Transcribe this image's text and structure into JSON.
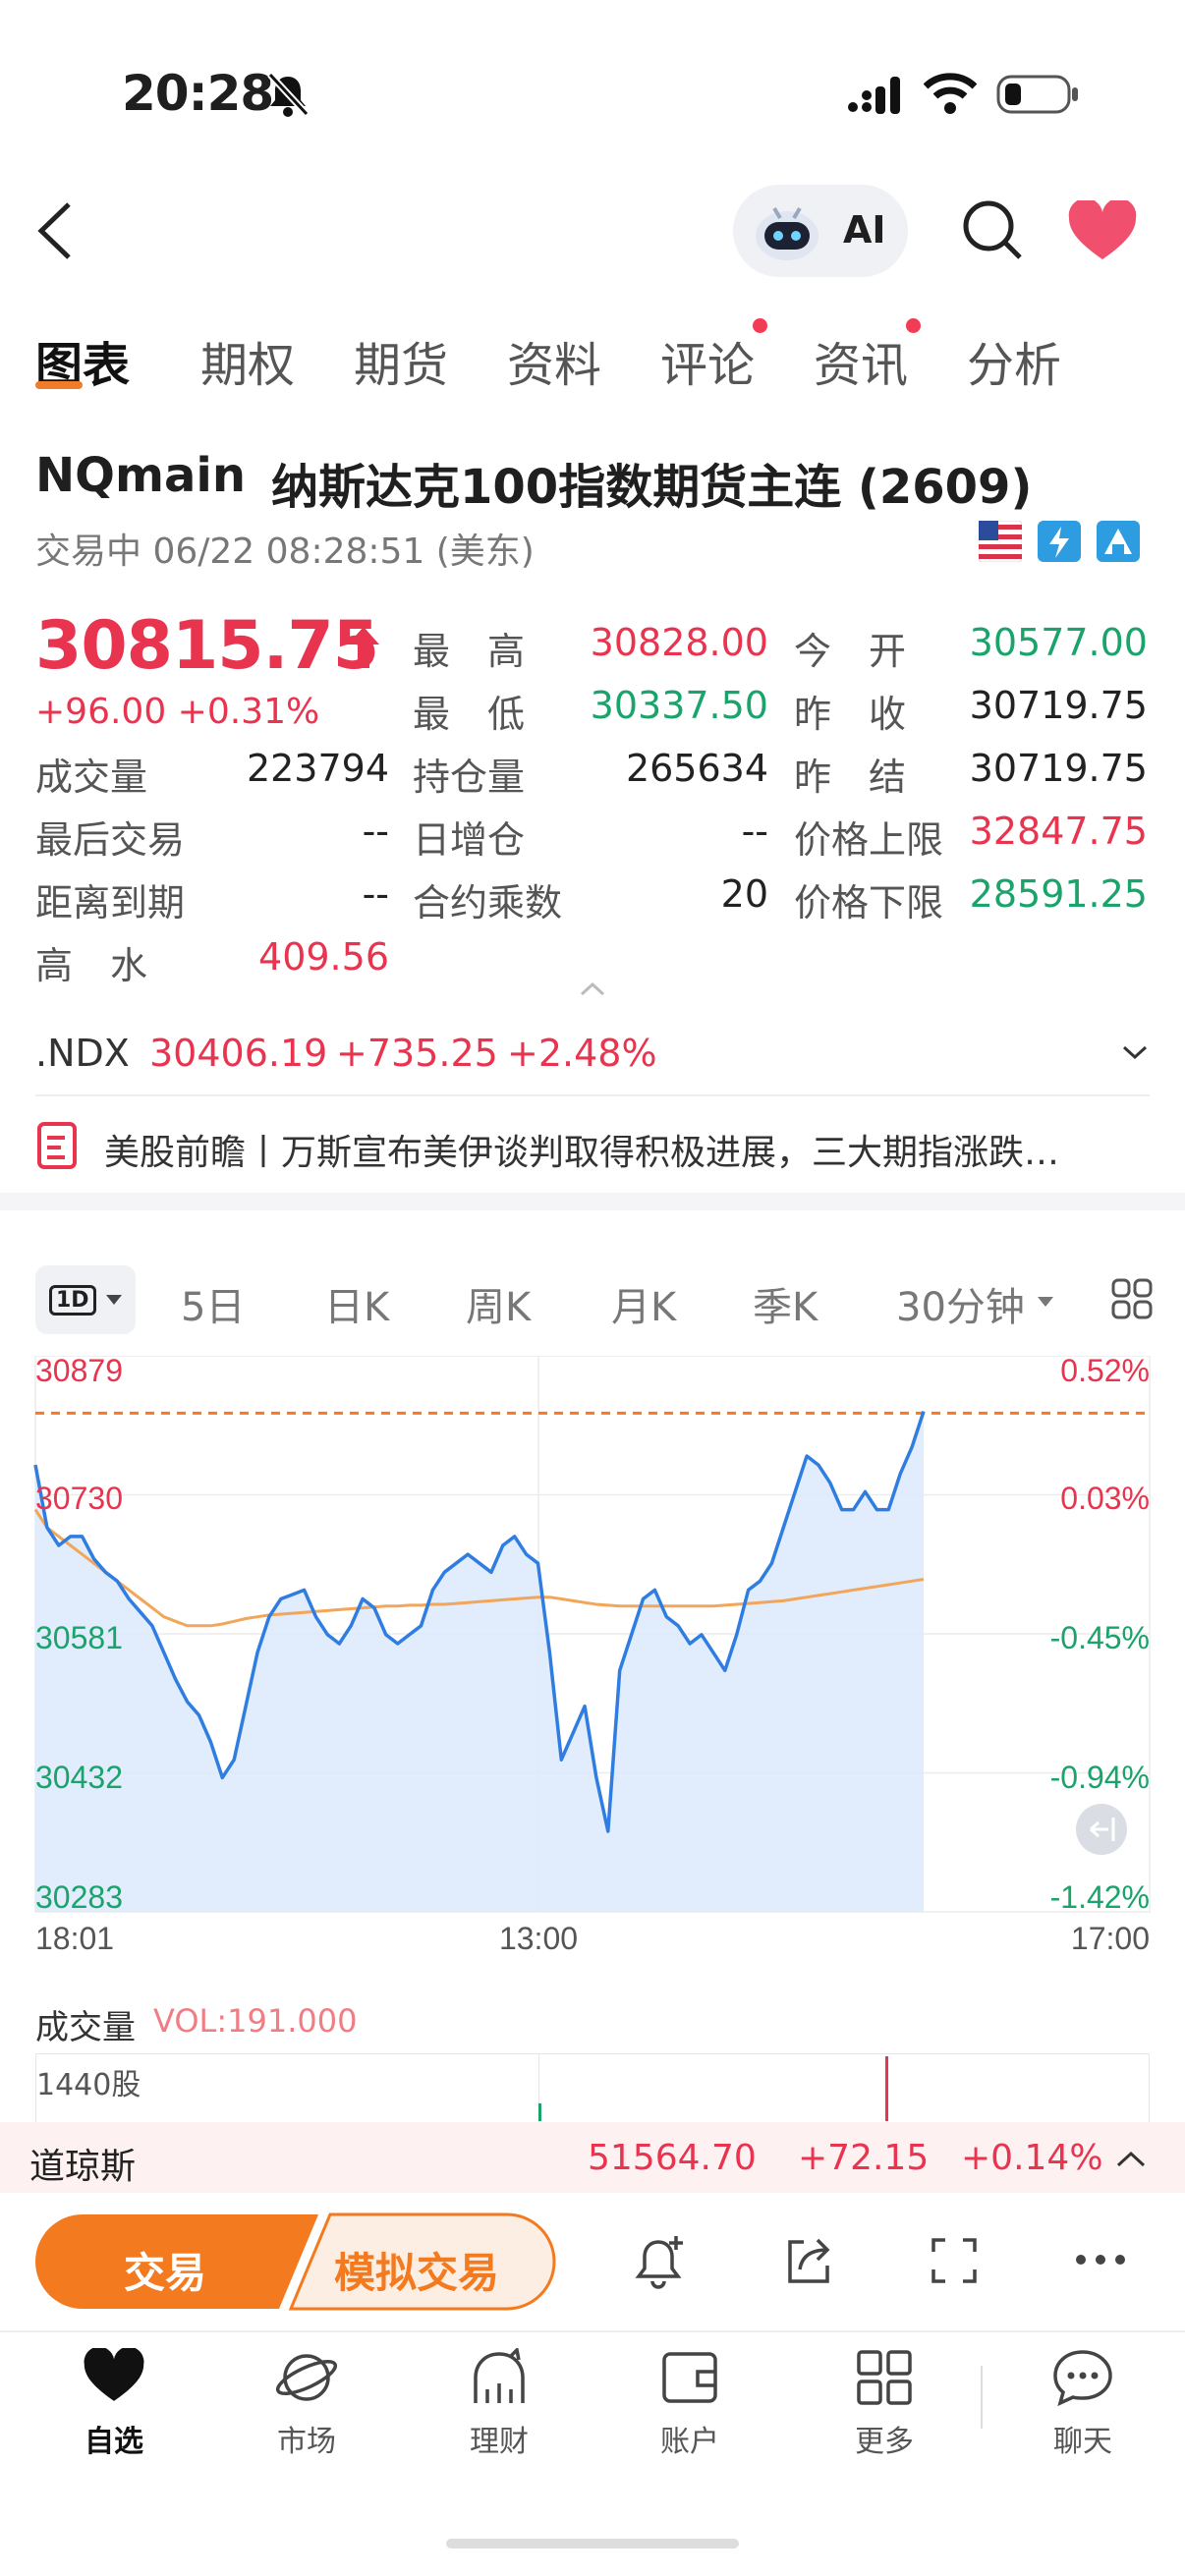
{
  "status": {
    "time": "20:28"
  },
  "header": {
    "ai_label": "AI"
  },
  "tabs": [
    {
      "label": "图表",
      "active": true,
      "dot": false
    },
    {
      "label": "期权",
      "active": false,
      "dot": false
    },
    {
      "label": "期货",
      "active": false,
      "dot": false
    },
    {
      "label": "资料",
      "active": false,
      "dot": false
    },
    {
      "label": "评论",
      "active": false,
      "dot": true
    },
    {
      "label": "资讯",
      "active": false,
      "dot": true
    },
    {
      "label": "分析",
      "active": false,
      "dot": false
    }
  ],
  "instrument": {
    "symbol": "NQmain",
    "name": "纳斯达克100指数期货主连 (2609)",
    "status": "交易中 06/22 08:28:51 (美东)"
  },
  "quote": {
    "price": "30815.75",
    "change": "+96.00 +0.31%",
    "high_label": "最　高",
    "high": "30828.00",
    "low_label": "最　低",
    "low": "30337.50",
    "open_label": "今　开",
    "open": "30577.00",
    "prev_close_label": "昨　收",
    "prev_close": "30719.75",
    "volume_label": "成交量",
    "volume": "223794",
    "oi_label": "持仓量",
    "oi": "265634",
    "prev_settle_label": "昨　结",
    "prev_settle": "30719.75",
    "last_trade_label": "最后交易",
    "last_trade": "--",
    "daily_oi_label": "日增仓",
    "daily_oi": "--",
    "upper_limit_label": "价格上限",
    "upper_limit": "32847.75",
    "to_expiry_label": "距离到期",
    "to_expiry": "--",
    "multiplier_label": "合约乘数",
    "multiplier": "20",
    "lower_limit_label": "价格下限",
    "lower_limit": "28591.25",
    "premium_label": "高　水",
    "premium": "409.56"
  },
  "index": {
    "symbol": ".NDX",
    "price": "30406.19",
    "change": "+735.25",
    "pct": "+2.48%"
  },
  "news": {
    "text": "美股前瞻丨万斯宣布美伊谈判取得积极进展，三大期指涨跌…"
  },
  "timeframes": {
    "selected": "1D",
    "items": [
      "5日",
      "日K",
      "周K",
      "月K",
      "季K",
      "30分钟"
    ]
  },
  "chart_data": {
    "type": "area",
    "y_ticks": [
      "30879",
      "30730",
      "30581",
      "30432",
      "30283"
    ],
    "pct_ticks": [
      "0.52%",
      "0.03%",
      "-0.45%",
      "-0.94%",
      "-1.42%"
    ],
    "x_ticks": [
      "18:01",
      "13:00",
      "17:00"
    ],
    "ylim": [
      30283,
      30879
    ],
    "reference_price": 30828.0,
    "price_series": [
      30770,
      30700,
      30680,
      30690,
      30690,
      30665,
      30650,
      30640,
      30620,
      30605,
      30590,
      30560,
      30530,
      30505,
      30490,
      30460,
      30420,
      30440,
      30500,
      30560,
      30600,
      30620,
      30625,
      30630,
      30600,
      30580,
      30570,
      30590,
      30620,
      30610,
      30580,
      30570,
      30580,
      30590,
      30630,
      30650,
      30660,
      30670,
      30660,
      30650,
      30680,
      30690,
      30670,
      30660,
      30560,
      30440,
      30470,
      30500,
      30420,
      30360,
      30540,
      30580,
      30620,
      30630,
      30600,
      30590,
      30570,
      30580,
      30560,
      30540,
      30580,
      30630,
      30640,
      30660,
      30700,
      30740,
      30780,
      30770,
      30750,
      30720,
      30720,
      30740,
      30720,
      30720,
      30760,
      30790,
      30830
    ],
    "avg_series": [
      30720,
      30700,
      30690,
      30680,
      30670,
      30660,
      30650,
      30640,
      30630,
      30620,
      30610,
      30600,
      30595,
      30590,
      30590,
      30590,
      30592,
      30595,
      30598,
      30600,
      30602,
      30603,
      30604,
      30605,
      30606,
      30607,
      30608,
      30609,
      30610,
      30611,
      30612,
      30612,
      30613,
      30613,
      30614,
      30614,
      30615,
      30616,
      30617,
      30618,
      30619,
      30620,
      30621,
      30622,
      30622,
      30620,
      30618,
      30616,
      30614,
      30613,
      30612,
      30612,
      30612,
      30612,
      30612,
      30612,
      30612,
      30612,
      30612,
      30613,
      30614,
      30615,
      30616,
      30617,
      30618,
      30620,
      30622,
      30624,
      30626,
      30628,
      30630,
      30632,
      30634,
      30636,
      30638,
      30640,
      30642
    ],
    "colors": {
      "line": "#2f7de1",
      "fill": "#dce9fb",
      "avg": "#f2a65a",
      "ref": "#f07c2a"
    }
  },
  "volume": {
    "label": "成交量",
    "vol_text": "VOL:191.000",
    "scale": "1440股"
  },
  "ticker": {
    "name": "道琼斯",
    "price": "51564.70",
    "change": "+72.15",
    "pct": "+0.14%"
  },
  "actions": {
    "trade": "交易",
    "sim_trade": "模拟交易"
  },
  "bottom_nav": [
    {
      "label": "自选",
      "icon": "heart-icon",
      "active": true
    },
    {
      "label": "市场",
      "icon": "planet-icon",
      "active": false
    },
    {
      "label": "理财",
      "icon": "piggy-bank-icon",
      "active": false
    },
    {
      "label": "账户",
      "icon": "wallet-icon",
      "active": false
    },
    {
      "label": "更多",
      "icon": "grid-icon",
      "active": false
    },
    {
      "label": "聊天",
      "icon": "chat-icon",
      "active": false
    }
  ]
}
